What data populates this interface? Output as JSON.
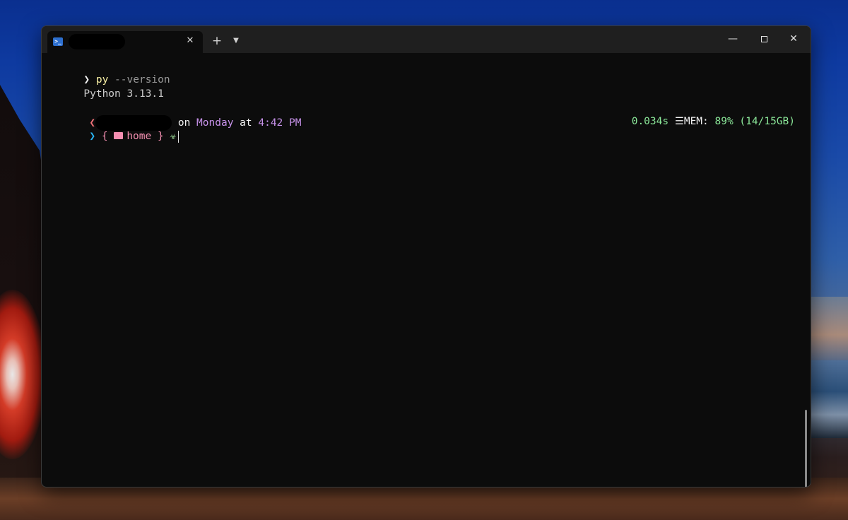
{
  "window": {
    "tab": {
      "icon": "powershell-icon",
      "title": "",
      "close_glyph": "✕"
    },
    "new_tab_glyph": "+",
    "dropdown_glyph": "⌄",
    "controls": {
      "minimize": "—",
      "close": "✕"
    }
  },
  "terminal": {
    "line1": {
      "prompt_glyph": "❯",
      "command": "py",
      "args": " --version"
    },
    "line2": {
      "output": "Python 3.13.1"
    },
    "line3": {
      "prompt_glyph": "❮",
      "on": " on ",
      "day": "Monday",
      "at": " at ",
      "time": "4:42 PM"
    },
    "status": {
      "duration": "0.034s",
      "mem_icon": "memory-icon",
      "mem_glyph": "☰",
      "mem_label": "MEM: ",
      "mem_value": "89% (14/15GB)"
    },
    "line4": {
      "prompt_glyph": "❯",
      "open_brace": "{ ",
      "folder_icon": "folder-icon",
      "dir": "home",
      "close_brace": " }",
      "symbol_icon": "biohazard-icon",
      "symbol_glyph": "☣"
    }
  },
  "colors": {
    "terminal_bg": "#0c0c0c",
    "titlebar_bg": "#1f1f1f",
    "purple": "#c792ea",
    "pink": "#f48fb1",
    "cyan": "#29b6f6",
    "green": "#a5e8a0"
  }
}
